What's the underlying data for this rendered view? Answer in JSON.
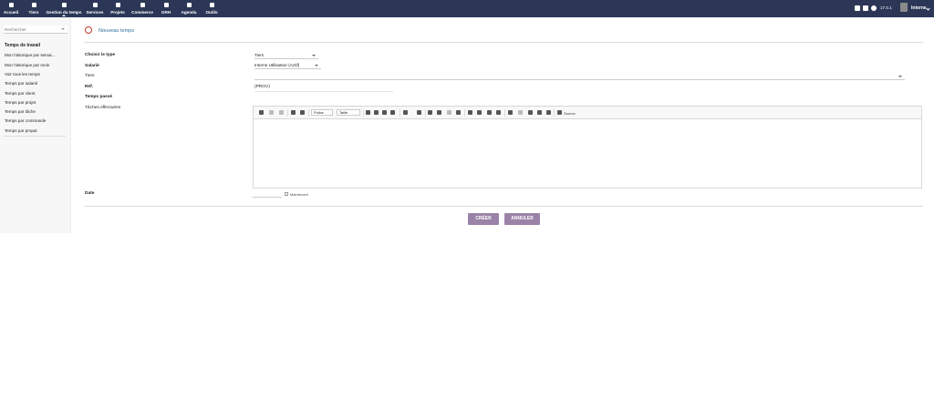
{
  "topnav": {
    "items": [
      {
        "label": "Accueil",
        "icon": "home-icon"
      },
      {
        "label": "Tiers",
        "icon": "building-icon"
      },
      {
        "label": "Gestion du temps",
        "icon": "clock-icon"
      },
      {
        "label": "Services",
        "icon": "cube-icon"
      },
      {
        "label": "Projets",
        "icon": "sitemap-icon"
      },
      {
        "label": "Commerce",
        "icon": "briefcase-icon"
      },
      {
        "label": "GRH",
        "icon": "user-icon"
      },
      {
        "label": "Agenda",
        "icon": "calendar-icon"
      },
      {
        "label": "Outils",
        "icon": "wrench-icon"
      }
    ],
    "version": "17.0.1",
    "username": "Interne"
  },
  "sidebar": {
    "search_placeholder": "Rechercher",
    "heading": "Temps de travail",
    "items": [
      "Mon historique par semai...",
      "Mon historique par mois",
      "Voir tous les temps",
      "Temps par salarié",
      "Temps par client",
      "Temps par projet",
      "Temps par tâche",
      "Temps par commande",
      "Temps par propal"
    ]
  },
  "page": {
    "title": "Nouveau temps"
  },
  "form": {
    "type_label": "Choisir le type",
    "type_value": "Tiers",
    "salarie_label": "Salarié",
    "salarie_value": "Interne Utilisateur (Actif)",
    "tiers_label": "Tiers",
    "tiers_value": "",
    "ref_label": "Réf.",
    "ref_value": "(PROV)",
    "temps_label": "Temps passé",
    "taches_label": "Tâches effectuées",
    "date_label": "Date",
    "date_now": "Maintenant"
  },
  "editor": {
    "police": "Police",
    "taille": "Taille",
    "source": "Source"
  },
  "buttons": {
    "create": "CRÉER",
    "cancel": "ANNULER"
  },
  "colors": {
    "topbar": "#2c3758",
    "button": "#9b83a8",
    "title": "#2c6e9a"
  }
}
